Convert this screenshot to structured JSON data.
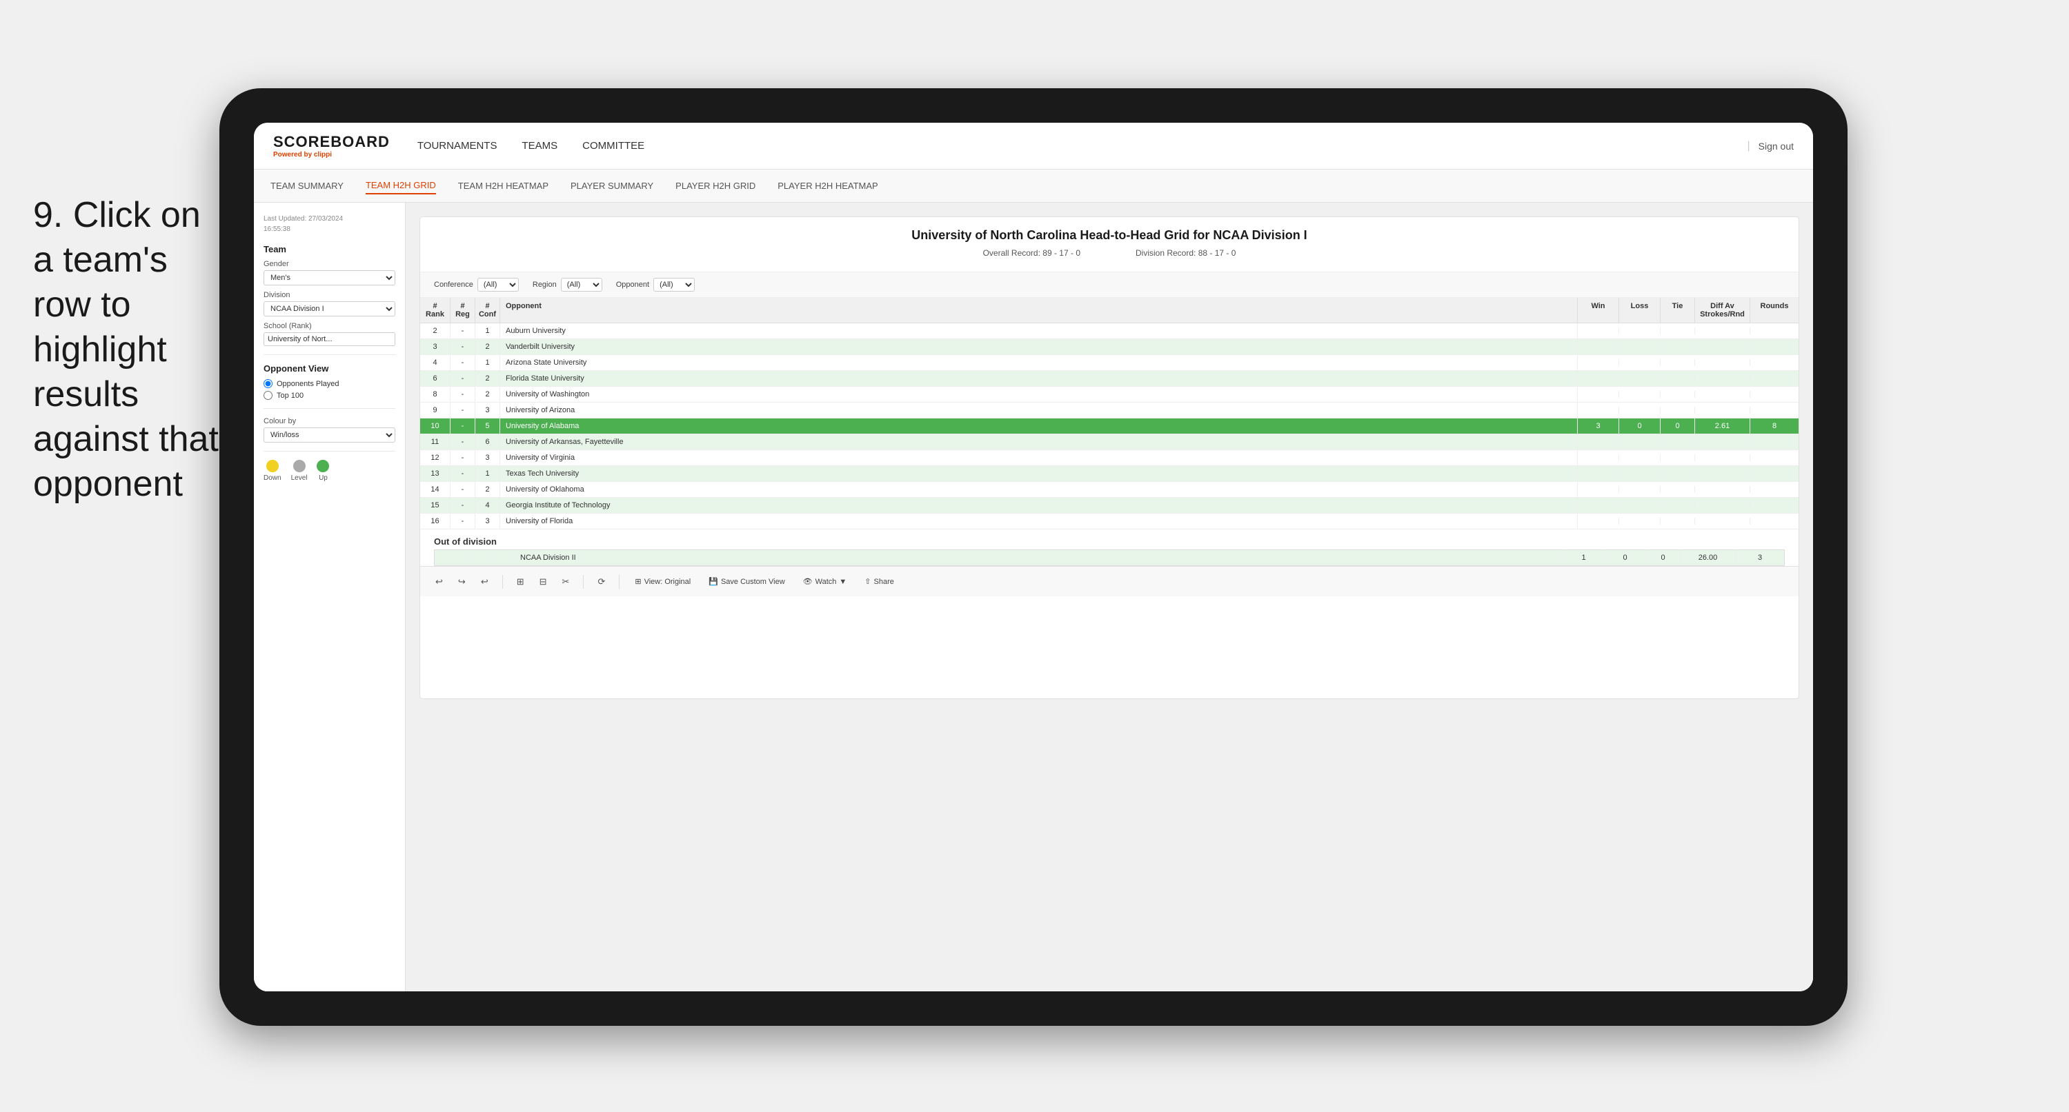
{
  "instruction": {
    "step": "9.",
    "text": "Click on a team's row to highlight results against that opponent"
  },
  "nav": {
    "logo": "SCOREBOARD",
    "logo_sub": "Powered by",
    "logo_brand": "clippi",
    "items": [
      "TOURNAMENTS",
      "TEAMS",
      "COMMITTEE"
    ],
    "sign_out": "Sign out"
  },
  "tabs": [
    {
      "label": "TEAM SUMMARY",
      "active": false
    },
    {
      "label": "TEAM H2H GRID",
      "active": true
    },
    {
      "label": "TEAM H2H HEATMAP",
      "active": false
    },
    {
      "label": "PLAYER SUMMARY",
      "active": false
    },
    {
      "label": "PLAYER H2H GRID",
      "active": false
    },
    {
      "label": "PLAYER H2H HEATMAP",
      "active": false
    }
  ],
  "sidebar": {
    "last_updated_label": "Last Updated: 27/03/2024",
    "last_updated_time": "16:55:38",
    "team_label": "Team",
    "gender_label": "Gender",
    "gender_value": "Men's",
    "division_label": "Division",
    "division_value": "NCAA Division I",
    "school_label": "School (Rank)",
    "school_value": "University of Nort...",
    "opponent_view_label": "Opponent View",
    "radio_opponents": "Opponents Played",
    "radio_top100": "Top 100",
    "colour_by_label": "Colour by",
    "colour_by_value": "Win/loss",
    "legend": {
      "down_label": "Down",
      "down_color": "#f0d020",
      "level_label": "Level",
      "level_color": "#aaaaaa",
      "up_label": "Up",
      "up_color": "#4caf50"
    }
  },
  "report": {
    "title": "University of North Carolina Head-to-Head Grid for NCAA Division I",
    "overall_record_label": "Overall Record:",
    "overall_record": "89 - 17 - 0",
    "division_record_label": "Division Record:",
    "division_record": "88 - 17 - 0",
    "filters": {
      "conference_label": "Conference",
      "conference_value": "(All)",
      "region_label": "Region",
      "region_value": "(All)",
      "opponent_label": "Opponent",
      "opponent_value": "(All)"
    },
    "col_headers": {
      "rank": "#\nRank",
      "reg": "#\nReg",
      "conf": "#\nConf",
      "opponent": "Opponent",
      "win": "Win",
      "loss": "Loss",
      "tie": "Tie",
      "diff": "Diff Av\nStrokes/Rnd",
      "rounds": "Rounds"
    },
    "rows": [
      {
        "rank": "2",
        "reg": "-",
        "conf": "1",
        "opponent": "Auburn University",
        "win": "",
        "loss": "",
        "tie": "",
        "diff": "",
        "rounds": "",
        "style": "normal"
      },
      {
        "rank": "3",
        "reg": "-",
        "conf": "2",
        "opponent": "Vanderbilt University",
        "win": "",
        "loss": "",
        "tie": "",
        "diff": "",
        "rounds": "",
        "style": "light-green"
      },
      {
        "rank": "4",
        "reg": "-",
        "conf": "1",
        "opponent": "Arizona State University",
        "win": "",
        "loss": "",
        "tie": "",
        "diff": "",
        "rounds": "",
        "style": "normal"
      },
      {
        "rank": "6",
        "reg": "-",
        "conf": "2",
        "opponent": "Florida State University",
        "win": "",
        "loss": "",
        "tie": "",
        "diff": "",
        "rounds": "",
        "style": "light-green"
      },
      {
        "rank": "8",
        "reg": "-",
        "conf": "2",
        "opponent": "University of Washington",
        "win": "",
        "loss": "",
        "tie": "",
        "diff": "",
        "rounds": "",
        "style": "normal"
      },
      {
        "rank": "9",
        "reg": "-",
        "conf": "3",
        "opponent": "University of Arizona",
        "win": "",
        "loss": "",
        "tie": "",
        "diff": "",
        "rounds": "",
        "style": "normal"
      },
      {
        "rank": "10",
        "reg": "-",
        "conf": "5",
        "opponent": "University of Alabama",
        "win": "3",
        "loss": "0",
        "tie": "0",
        "diff": "2.61",
        "rounds": "8",
        "style": "highlighted"
      },
      {
        "rank": "11",
        "reg": "-",
        "conf": "6",
        "opponent": "University of Arkansas, Fayetteville",
        "win": "",
        "loss": "",
        "tie": "",
        "diff": "",
        "rounds": "",
        "style": "light-green"
      },
      {
        "rank": "12",
        "reg": "-",
        "conf": "3",
        "opponent": "University of Virginia",
        "win": "",
        "loss": "",
        "tie": "",
        "diff": "",
        "rounds": "",
        "style": "normal"
      },
      {
        "rank": "13",
        "reg": "-",
        "conf": "1",
        "opponent": "Texas Tech University",
        "win": "",
        "loss": "",
        "tie": "",
        "diff": "",
        "rounds": "",
        "style": "light-green"
      },
      {
        "rank": "14",
        "reg": "-",
        "conf": "2",
        "opponent": "University of Oklahoma",
        "win": "",
        "loss": "",
        "tie": "",
        "diff": "",
        "rounds": "",
        "style": "normal"
      },
      {
        "rank": "15",
        "reg": "-",
        "conf": "4",
        "opponent": "Georgia Institute of Technology",
        "win": "",
        "loss": "",
        "tie": "",
        "diff": "",
        "rounds": "",
        "style": "light-green"
      },
      {
        "rank": "16",
        "reg": "-",
        "conf": "3",
        "opponent": "University of Florida",
        "win": "",
        "loss": "",
        "tie": "",
        "diff": "",
        "rounds": "",
        "style": "normal"
      }
    ],
    "out_of_division_label": "Out of division",
    "ood_row": {
      "label": "NCAA Division II",
      "win": "1",
      "loss": "0",
      "tie": "0",
      "diff": "26.00",
      "rounds": "3"
    }
  },
  "toolbar": {
    "view_label": "View: Original",
    "save_label": "Save Custom View",
    "watch_label": "Watch",
    "share_label": "Share"
  }
}
